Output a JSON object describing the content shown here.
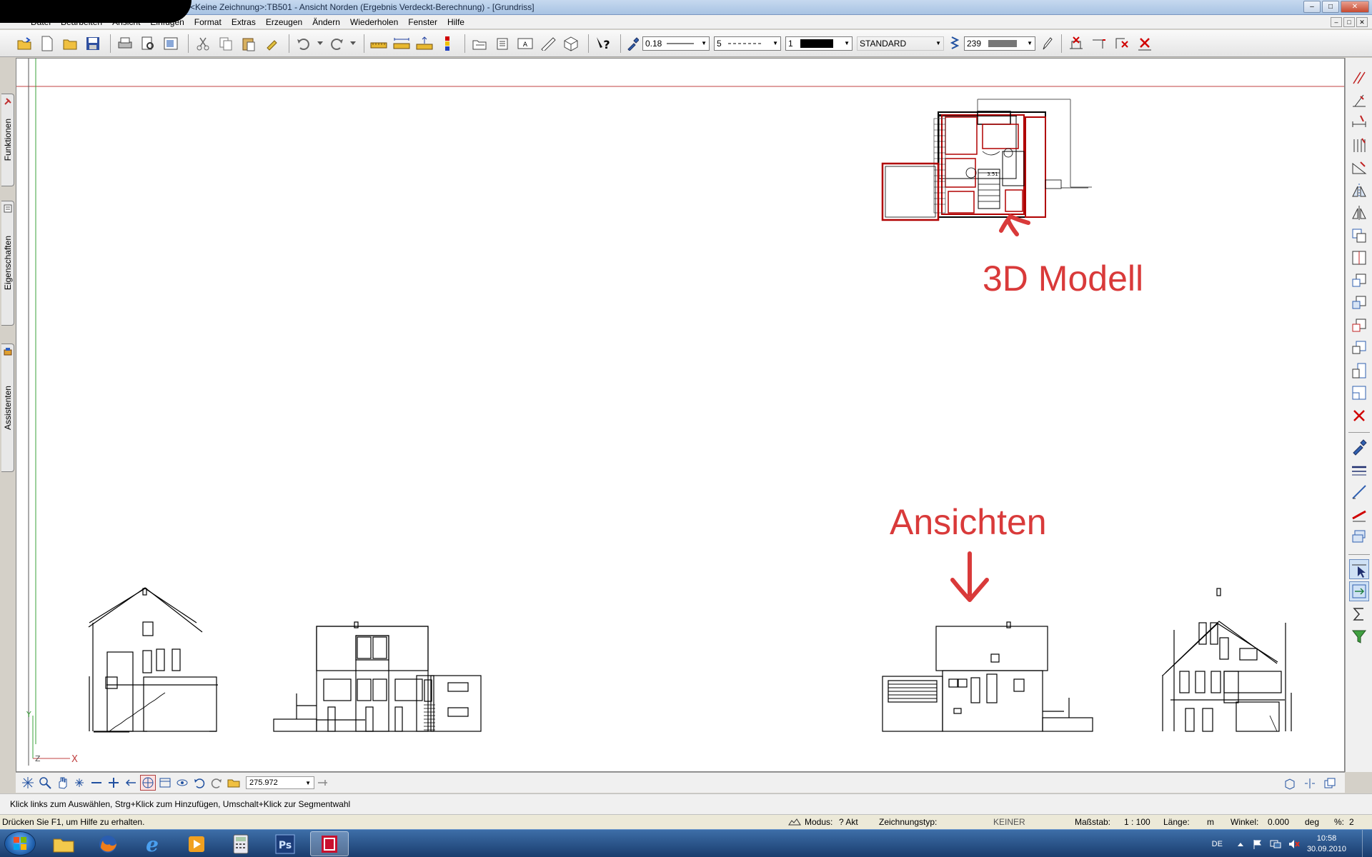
{
  "window": {
    "title": "<Keine Zeichnung>:TB501 - Ansicht Norden (Ergebnis Verdeckt-Berechnung) - [Grundriss]",
    "min": "–",
    "max": "□",
    "close": "✕"
  },
  "menu": {
    "items": [
      "Datei",
      "Bearbeiten",
      "Ansicht",
      "Einfügen",
      "Format",
      "Extras",
      "Erzeugen",
      "Ändern",
      "Wiederholen",
      "Fenster",
      "Hilfe"
    ]
  },
  "toolbar": {
    "pen_thickness": "0.18",
    "line_type": "5",
    "color_index": "1",
    "layer": "STANDARD",
    "fill_index": "239"
  },
  "sidebar": {
    "tabs": [
      "Funktionen",
      "Eigenschaften",
      "Assistenten"
    ]
  },
  "canvas": {
    "annotation_model": "3D Modell",
    "annotation_views": "Ansichten",
    "axis_y": "Y",
    "axis_z": "Z",
    "axis_x": "X",
    "plan_label": "3.51"
  },
  "navbar": {
    "zoom_value": "275.972"
  },
  "hint": {
    "text": "Klick links zum Auswählen, Strg+Klick zum Hinzufügen, Umschalt+Klick zur Segmentwahl"
  },
  "status": {
    "help": "Drücken Sie F1, um Hilfe zu erhalten.",
    "mode_label": "Modus:",
    "mode_value": "? Akt",
    "drawing_type_label": "Zeichnungstyp:",
    "drawing_type_value": "KEINER",
    "scale_label": "Maßstab:",
    "scale_value": "1 : 100",
    "length_label": "Länge:",
    "length_unit": "m",
    "angle_label": "Winkel:",
    "angle_value": "0.000",
    "angle_unit": "deg",
    "percent_label": "%:",
    "percent_value": "2"
  },
  "taskbar": {
    "language": "DE",
    "time": "10:58",
    "date": "30.09.2010",
    "ps_label": "Ps"
  },
  "colors": {
    "annotation": "#d93a3a",
    "plan_red": "#b00000",
    "guide_red": "#c04040",
    "guide_green": "#3aa03a"
  }
}
